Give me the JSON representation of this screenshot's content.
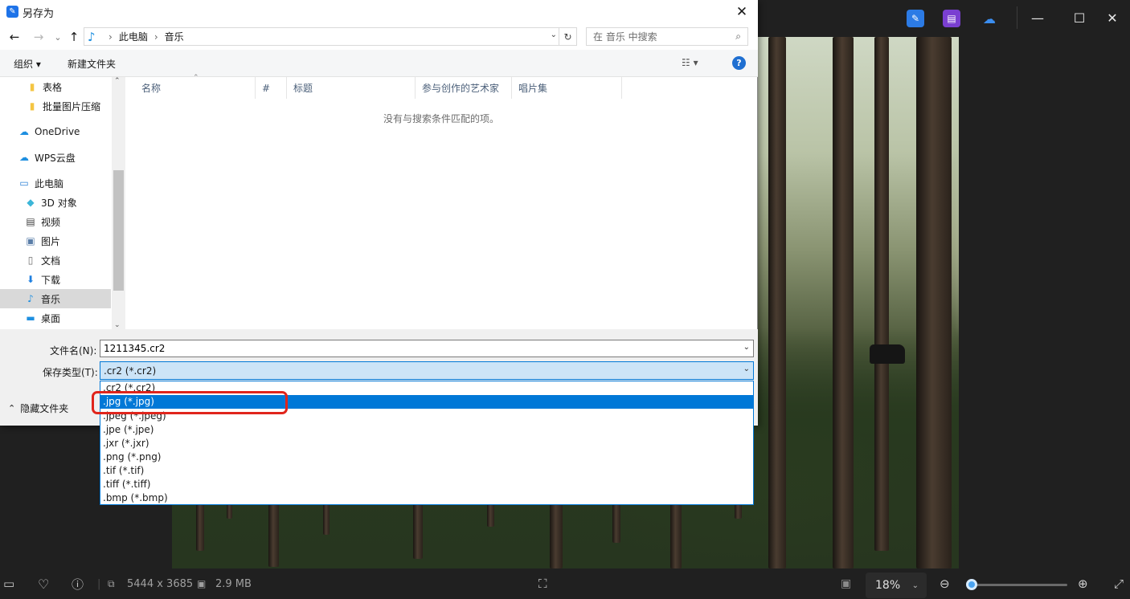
{
  "dialog": {
    "title": "另存为",
    "close_glyph": "✕",
    "nav": {
      "back_glyph": "←",
      "forward_glyph": "→",
      "recent_glyph": "⌄",
      "up_glyph": "↑",
      "breadcrumb": [
        "此电脑",
        "音乐"
      ],
      "breadcrumb_separator": "›",
      "refresh_glyph": "↻",
      "search_placeholder": "在 音乐 中搜索"
    },
    "toolbar": {
      "organize_label": "组织 ▾",
      "new_folder_label": "新建文件夹",
      "view_glyph": "☷ ▾",
      "help_glyph": "?"
    },
    "sidebar": {
      "items": [
        {
          "label": "表格",
          "icon": "folder-icon"
        },
        {
          "label": "批量图片压缩",
          "icon": "folder-icon"
        },
        {
          "label": "OneDrive",
          "icon": "cloud-icon"
        },
        {
          "label": "WPS云盘",
          "icon": "cloud-icon"
        },
        {
          "label": "此电脑",
          "icon": "computer-icon"
        },
        {
          "label": "3D 对象",
          "icon": "cube-icon"
        },
        {
          "label": "视频",
          "icon": "video-icon"
        },
        {
          "label": "图片",
          "icon": "picture-icon"
        },
        {
          "label": "文档",
          "icon": "document-icon"
        },
        {
          "label": "下载",
          "icon": "download-icon"
        },
        {
          "label": "音乐",
          "icon": "music-icon",
          "selected": true
        },
        {
          "label": "桌面",
          "icon": "desktop-icon"
        }
      ]
    },
    "columns": [
      "名称",
      "#",
      "标题",
      "参与创作的艺术家",
      "唱片集"
    ],
    "empty_message": "没有与搜索条件匹配的项。",
    "filename_label": "文件名(N):",
    "filename_value": "1211345.cr2",
    "filetype_label": "保存类型(T):",
    "filetype_selected": ".cr2 (*.cr2)",
    "filetype_options": [
      ".cr2 (*.cr2)",
      ".jpg (*.jpg)",
      ".jpeg (*.jpeg)",
      ".jpe (*.jpe)",
      ".jxr (*.jxr)",
      ".png (*.png)",
      ".tif (*.tif)",
      ".tiff (*.tiff)",
      ".bmp (*.bmp)"
    ],
    "highlighted_option_index": 1,
    "hide_folders_label": "隐藏文件夹",
    "hide_folders_glyph": "⌃"
  },
  "viewer": {
    "window_controls": {
      "minimize": "—",
      "maximize": "☐",
      "close": "✕"
    },
    "status": {
      "dimensions": "5444 x 3685",
      "file_size": "2.9 MB",
      "zoom": "18%",
      "zoom_level": 0.0
    }
  },
  "colors": {
    "accent": "#0078d7",
    "selection_ring": "#e0251c",
    "viewer_bg": "#202020"
  }
}
